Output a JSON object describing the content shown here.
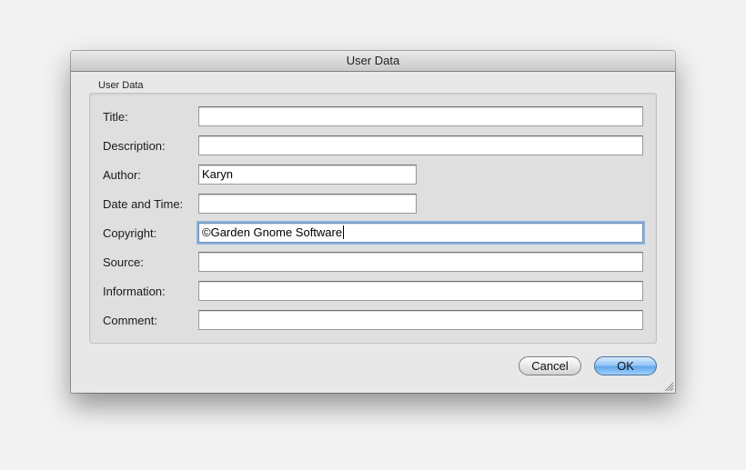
{
  "window": {
    "title": "User Data"
  },
  "group": {
    "label": "User Data"
  },
  "fields": [
    {
      "label": "Title:",
      "value": ""
    },
    {
      "label": "Description:",
      "value": ""
    },
    {
      "label": "Author:",
      "value": "Karyn"
    },
    {
      "label": "Date and Time:",
      "value": ""
    },
    {
      "label": "Copyright:",
      "value": "©Garden Gnome Software"
    },
    {
      "label": "Source:",
      "value": ""
    },
    {
      "label": "Information:",
      "value": ""
    },
    {
      "label": "Comment:",
      "value": ""
    }
  ],
  "buttons": {
    "cancel_label": "Cancel",
    "ok_label": "OK"
  },
  "icons": {
    "resize": "resize-grip-icon"
  },
  "colors": {
    "focus_ring": "#8fb3dd",
    "default_button": "#7fb8f0"
  }
}
